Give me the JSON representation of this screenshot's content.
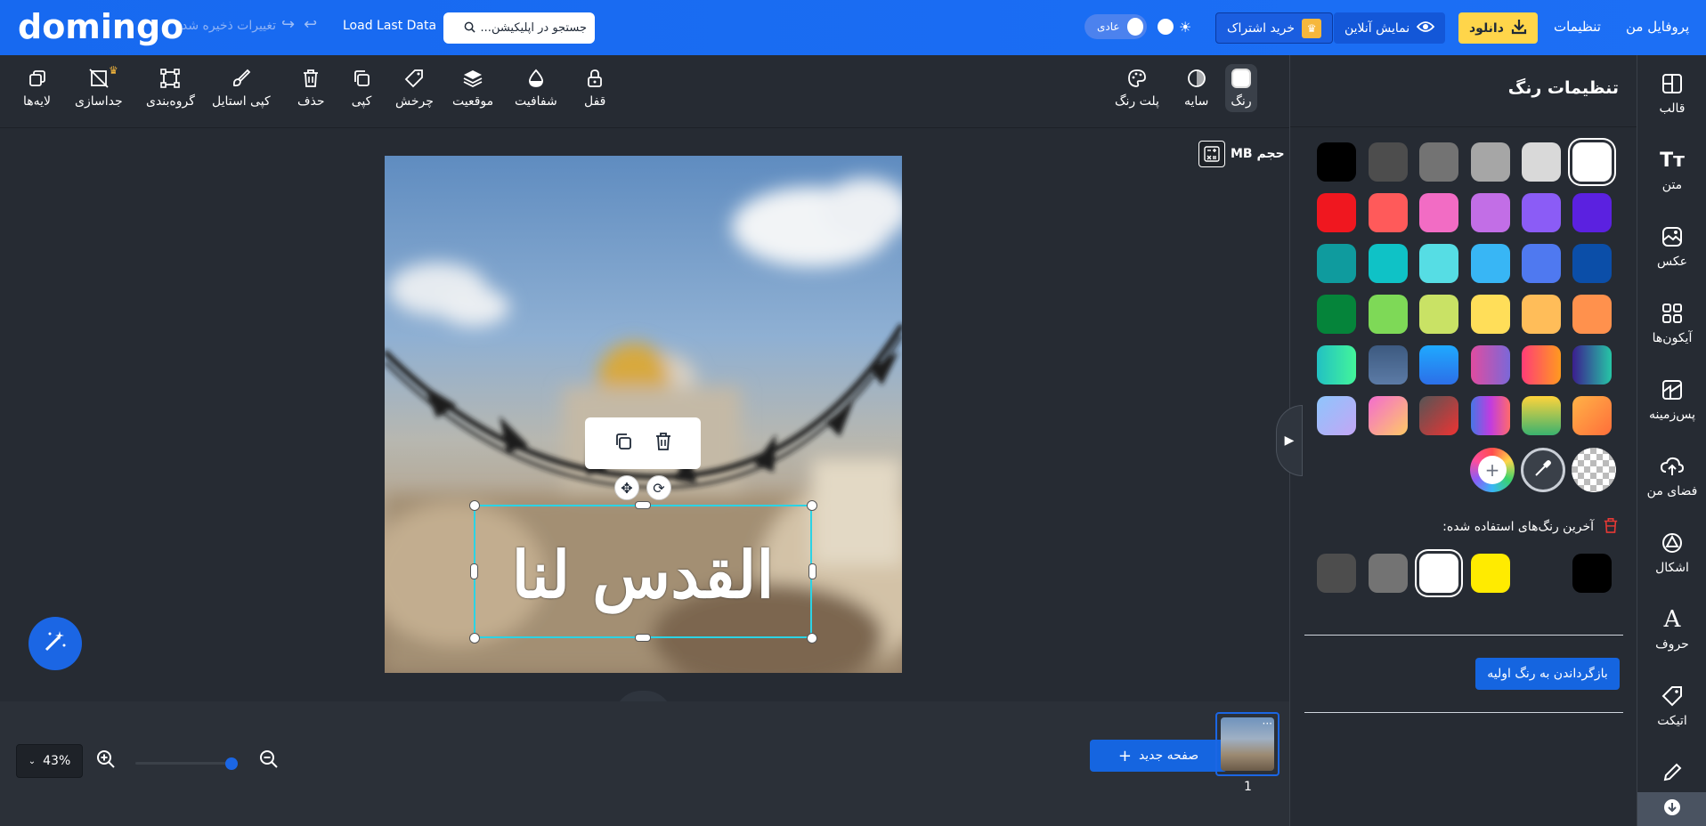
{
  "topbar": {
    "logo": "domingo",
    "saved_text": "تغییرات ذخیره شد",
    "load_last": "Load Last Data",
    "search_placeholder": "جستجو در اپلیکیشن...",
    "mode_label": "عادی",
    "subscribe_label": "خرید اشتراک",
    "preview_label": "نمایش آنلاین",
    "download_label": "دانلود",
    "settings_label": "تنظیمات",
    "profile_label": "پروفایل من"
  },
  "toolbar": {
    "left_tools": [
      {
        "label": "لایه‌ها",
        "icon": "layers-icon"
      },
      {
        "label": "جداسازی",
        "icon": "remove-bg-icon"
      },
      {
        "label": "گروه‌بندی",
        "icon": "group-icon"
      },
      {
        "label": "کپی استایل",
        "icon": "brush-icon"
      },
      {
        "label": "حذف",
        "icon": "trash-icon"
      },
      {
        "label": "کپی",
        "icon": "copy-icon"
      },
      {
        "label": "چرخش",
        "icon": "rotate-tag-icon"
      },
      {
        "label": "موقعیت",
        "icon": "position-icon"
      },
      {
        "label": "شفافیت",
        "icon": "opacity-icon"
      },
      {
        "label": "قفل",
        "icon": "lock-icon"
      }
    ],
    "right_tools": [
      {
        "label": "پلت رنگ",
        "icon": "palette-icon"
      },
      {
        "label": "سایه",
        "icon": "shadow-icon"
      },
      {
        "label": "رنگ",
        "icon": "color-swatch-icon"
      }
    ]
  },
  "canvas": {
    "size_label": "حجم MB",
    "zoom": "43%",
    "new_page": "صفحه جدید",
    "page_number": "1",
    "calligraphy_text": "القدس لنا"
  },
  "panel": {
    "title": "تنظیمات رنگ",
    "recent_title": "آخرین رنگ‌های استفاده شده:",
    "reset_label": "بازگرداندن به رنگ اولیه",
    "swatches": [
      [
        "#ffffff",
        "#d9d9d9",
        "#a6a6a6",
        "#737373",
        "#4d4d4d",
        "#000000"
      ],
      [
        "#5b21e0",
        "#8b5cf6",
        "#c26ee6",
        "#f26cc4",
        "#ff5a5a",
        "#f0171f"
      ],
      [
        "#0b4ea8",
        "#4f79f0",
        "#38b6f5",
        "#56dde4",
        "#0fc2c6",
        "#0f9b9e"
      ],
      [
        "#ff914d",
        "#ffbd59",
        "#ffde59",
        "#c9e265",
        "#7ed957",
        "#05843a"
      ],
      [
        "linear-gradient(90deg,#3b1e8f,#26c6a6)",
        "linear-gradient(90deg,#ff3d77,#ff9a1f)",
        "linear-gradient(90deg,#e04ca0,#7b68d8)",
        "linear-gradient(180deg,#1fa9ff,#2c6fe8)",
        "linear-gradient(180deg,#3d5a80,#5c7ba6)",
        "linear-gradient(90deg,#22c1c3,#43f59a)"
      ],
      [
        "linear-gradient(135deg,#ffb347,#ff6e3a)",
        "linear-gradient(180deg,#ffd43b,#3ab26f)",
        "linear-gradient(90deg,#4776e6,#c13ce0,#ff6b6b)",
        "linear-gradient(135deg,#555,#ee3333)",
        "linear-gradient(135deg,#f36ccf,#ffc966)",
        "linear-gradient(135deg,#8ec5fc,#c3a6f5)"
      ]
    ],
    "special_swatches": [
      "rainbow-add-icon",
      "eyedropper-icon",
      "transparent-icon"
    ],
    "recent_colors": [
      "#4d4d4d",
      "#737373",
      "#ffffff",
      "#ffeb00",
      "",
      "#000000"
    ]
  },
  "sidebar": {
    "items": [
      {
        "label": "قالب",
        "icon": "template-icon"
      },
      {
        "label": "متن",
        "icon": "text-icon"
      },
      {
        "label": "عکس",
        "icon": "image-icon"
      },
      {
        "label": "آیکون‌ها",
        "icon": "icons-grid-icon"
      },
      {
        "label": "پس‌زمینه",
        "icon": "background-icon"
      },
      {
        "label": "فضای من",
        "icon": "cloud-upload-icon"
      },
      {
        "label": "اشکال",
        "icon": "shapes-icon"
      },
      {
        "label": "حروف",
        "icon": "letters-icon"
      },
      {
        "label": "اتیکت",
        "icon": "tag-icon"
      }
    ]
  },
  "colors": {
    "brand_blue": "#1769f0",
    "accent_yellow": "#ffd54a",
    "selection_cyan": "#2bd3e5",
    "bg_dark": "#262b33"
  }
}
